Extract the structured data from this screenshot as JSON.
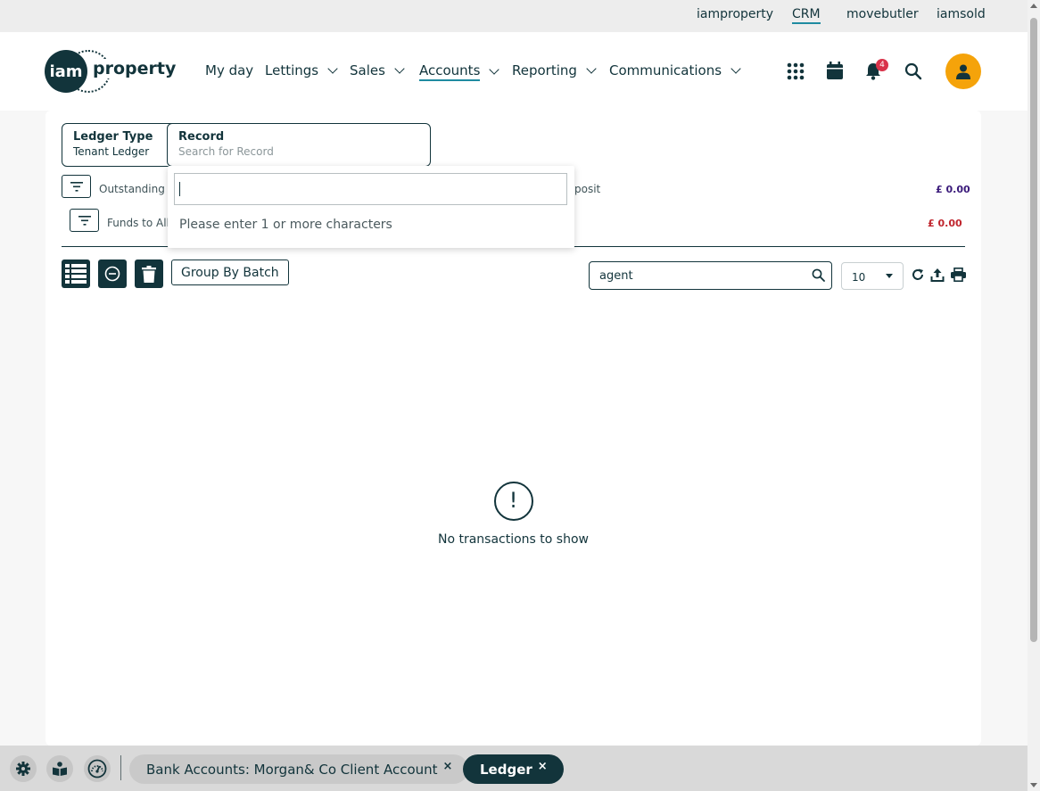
{
  "brand_bar": {
    "links": [
      "iamproperty",
      "CRM",
      "movebutler",
      "iamsold"
    ],
    "active": "CRM"
  },
  "header": {
    "logo_prefix": "iam",
    "logo_word": "property",
    "nav": {
      "my_day": "My day",
      "lettings": "Lettings",
      "sales": "Sales",
      "accounts": "Accounts",
      "reporting": "Reporting",
      "communications": "Communications"
    },
    "active_nav": "Accounts",
    "notification_count": "4",
    "icons": [
      "grid-icon",
      "calendar-icon",
      "bell-icon",
      "search-icon",
      "user-icon"
    ]
  },
  "filters": {
    "ledger_type": {
      "title": "Ledger Type",
      "value": "Tenant Ledger"
    },
    "record": {
      "title": "Record",
      "placeholder": "Search for Record"
    }
  },
  "summary": {
    "outstanding_label": "Outstanding I",
    "deposit_label": "posit",
    "deposit_amount": "£ 0.00",
    "funds_label": "Funds to All",
    "funds_amount": "£ 0.00"
  },
  "toolbar": {
    "group_by_batch": "Group By Batch",
    "search_value": "agent",
    "page_size": "10"
  },
  "empty_state": {
    "icon": "!",
    "message": "No transactions to show"
  },
  "record_dropdown": {
    "input_value": "",
    "hint": "Please enter 1 or more characters"
  },
  "bottom_bar": {
    "tabs": [
      {
        "label": "Bank Accounts: Morgan& Co Client Account",
        "close": "×"
      },
      {
        "label": "Ledger",
        "close": "×"
      }
    ]
  },
  "colors": {
    "primary": "#12343b",
    "accent": "#1f8ba1",
    "avatar": "#f5a30a",
    "badge": "#d9334a",
    "deposit_amount": "#3a1a7a",
    "funds_amount": "#c0262e"
  }
}
